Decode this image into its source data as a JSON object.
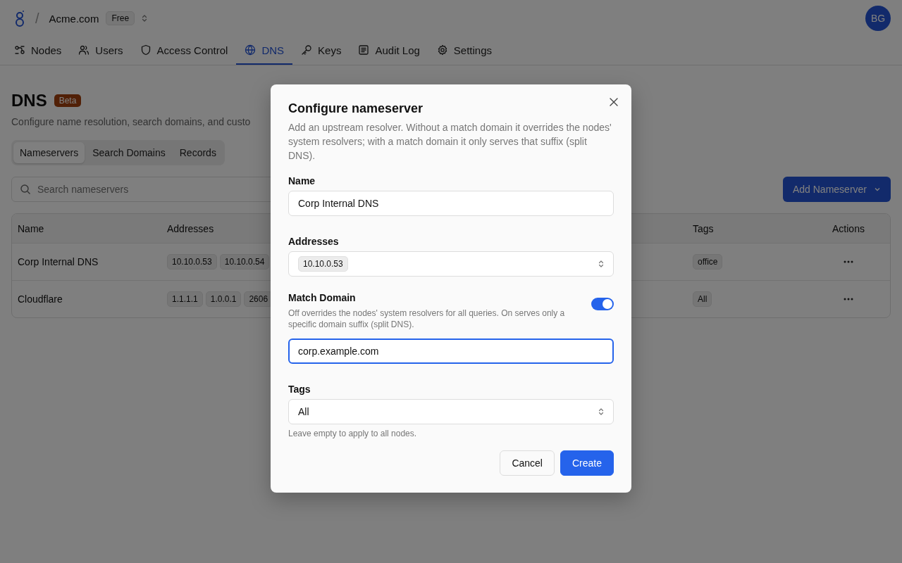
{
  "header": {
    "separator": "/",
    "org": "Acme.com",
    "plan": "Free",
    "avatar": "BG"
  },
  "nav": [
    {
      "label": "Nodes",
      "selected": false
    },
    {
      "label": "Users",
      "selected": false
    },
    {
      "label": "Access Control",
      "selected": false
    },
    {
      "label": "DNS",
      "selected": true
    },
    {
      "label": "Keys",
      "selected": false
    },
    {
      "label": "Audit Log",
      "selected": false
    },
    {
      "label": "Settings",
      "selected": false
    }
  ],
  "page": {
    "title": "DNS",
    "badge": "Beta",
    "subtitle": "Configure name resolution, search domains, and custo"
  },
  "tabs": [
    {
      "label": "Nameservers",
      "selected": true
    },
    {
      "label": "Search Domains",
      "selected": false
    },
    {
      "label": "Records",
      "selected": false
    }
  ],
  "search": {
    "placeholder": "Search nameservers"
  },
  "add_button": "Add Nameserver",
  "table": {
    "columns": [
      "Name",
      "Addresses",
      "Tags",
      "Actions"
    ],
    "rows": [
      {
        "name": "Corp Internal DNS",
        "addresses": [
          "10.10.0.53",
          "10.10.0.54"
        ],
        "tags": [
          "office"
        ]
      },
      {
        "name": "Cloudflare",
        "addresses": [
          "1.1.1.1",
          "1.0.0.1",
          "2606"
        ],
        "tags": [
          "All"
        ]
      }
    ]
  },
  "modal": {
    "title": "Configure nameserver",
    "description": "Add an upstream resolver. Without a match domain it overrides the nodes' system resolvers; with a match domain it only serves that suffix (split DNS).",
    "name": {
      "label": "Name",
      "value": "Corp Internal DNS",
      "focused": false
    },
    "addresses": {
      "label": "Addresses",
      "chips": [
        "10.10.0.53"
      ]
    },
    "match_domain": {
      "label": "Match Domain",
      "help": "Off overrides the nodes' system resolvers for all queries. On serves only a specific domain suffix (split DNS).",
      "on": true,
      "value": "corp.example.com",
      "focused": true
    },
    "tags": {
      "label": "Tags",
      "value": "All",
      "help": "Leave empty to apply to all nodes."
    },
    "buttons": [
      {
        "label": "Cancel",
        "kind": "secondary"
      },
      {
        "label": "Create",
        "kind": "primary"
      }
    ]
  }
}
